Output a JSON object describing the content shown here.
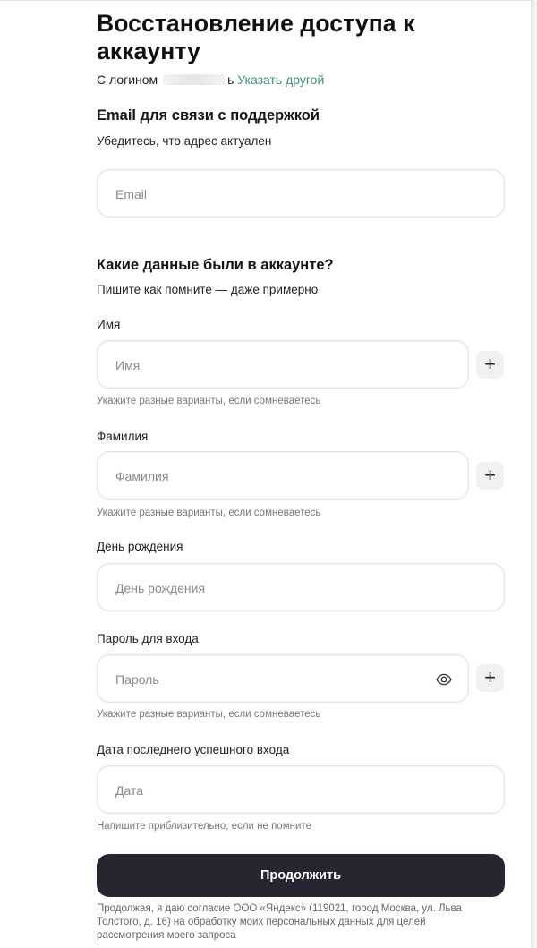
{
  "page": {
    "title": "Восстановление доступа к аккаунту",
    "login_prefix": "С логином",
    "login_tail": "ь",
    "change_login_link": "Указать другой"
  },
  "email_section": {
    "heading": "Email для связи с поддержкой",
    "subtitle": "Убедитесь, что адрес актуален",
    "email_placeholder": "Email"
  },
  "account_section": {
    "heading": "Какие данные были в аккаунте?",
    "subtitle": "Пишите как помните — даже примерно",
    "first_name": {
      "label": "Имя",
      "placeholder": "Имя",
      "hint": "Укажите разные варианты, если сомневаетесь",
      "add_icon": "+"
    },
    "last_name": {
      "label": "Фамилия",
      "placeholder": "Фамилия",
      "hint": "Укажите разные варианты, если сомневаетесь",
      "add_icon": "+"
    },
    "birthday": {
      "label": "День рождения",
      "placeholder": "День рождения"
    },
    "password": {
      "label": "Пароль для входа",
      "placeholder": "Пароль",
      "hint": "Укажите разные варианты, если сомневаетесь",
      "add_icon": "+"
    },
    "last_login": {
      "label": "Дата последнего успешного входа",
      "placeholder": "Дата",
      "hint": "Напишите приблизительно, если не помните"
    }
  },
  "submit_label": "Продолжить",
  "consent_text": "Продолжая, я даю согласие ООО «Яндекс» (119021, город Москва, ул. Льва Толстого, д. 16) на обработку моих персональных данных для целей рассмотрения моего запроса"
}
